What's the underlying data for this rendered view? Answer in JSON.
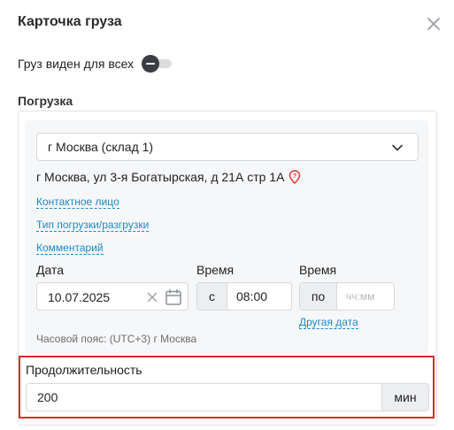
{
  "card": {
    "title": "Карточка груза",
    "close_icon": "close-icon"
  },
  "visibility": {
    "label": "Груз виден для всех",
    "toggle_on": false
  },
  "loading": {
    "section_title": "Погрузка",
    "warehouse_select": "г Москва (склад 1)",
    "address": "г Москва, ул 3-я Богатырская, д 21А стр 1А",
    "links": {
      "contact": "Контактное лицо",
      "load_type": "Тип погрузки/разгрузки",
      "comment": "Комментарий"
    },
    "date_label": "Дата",
    "date_value": "10.07.2025",
    "time_label_from": "Время",
    "time_prefix_from": "с",
    "time_value_from": "08:00",
    "time_label_to": "Время",
    "time_prefix_to": "по",
    "time_placeholder_to": "чч:мм",
    "other_date": "Другая дата",
    "timezone": "Часовой пояс: (UTC+3) г Москва",
    "duration_label": "Продолжительность",
    "duration_value": "200",
    "duration_unit": "мин"
  },
  "colors": {
    "accent_link": "#1e88c9",
    "highlight": "#d32f2f",
    "pin": "#e53935"
  }
}
